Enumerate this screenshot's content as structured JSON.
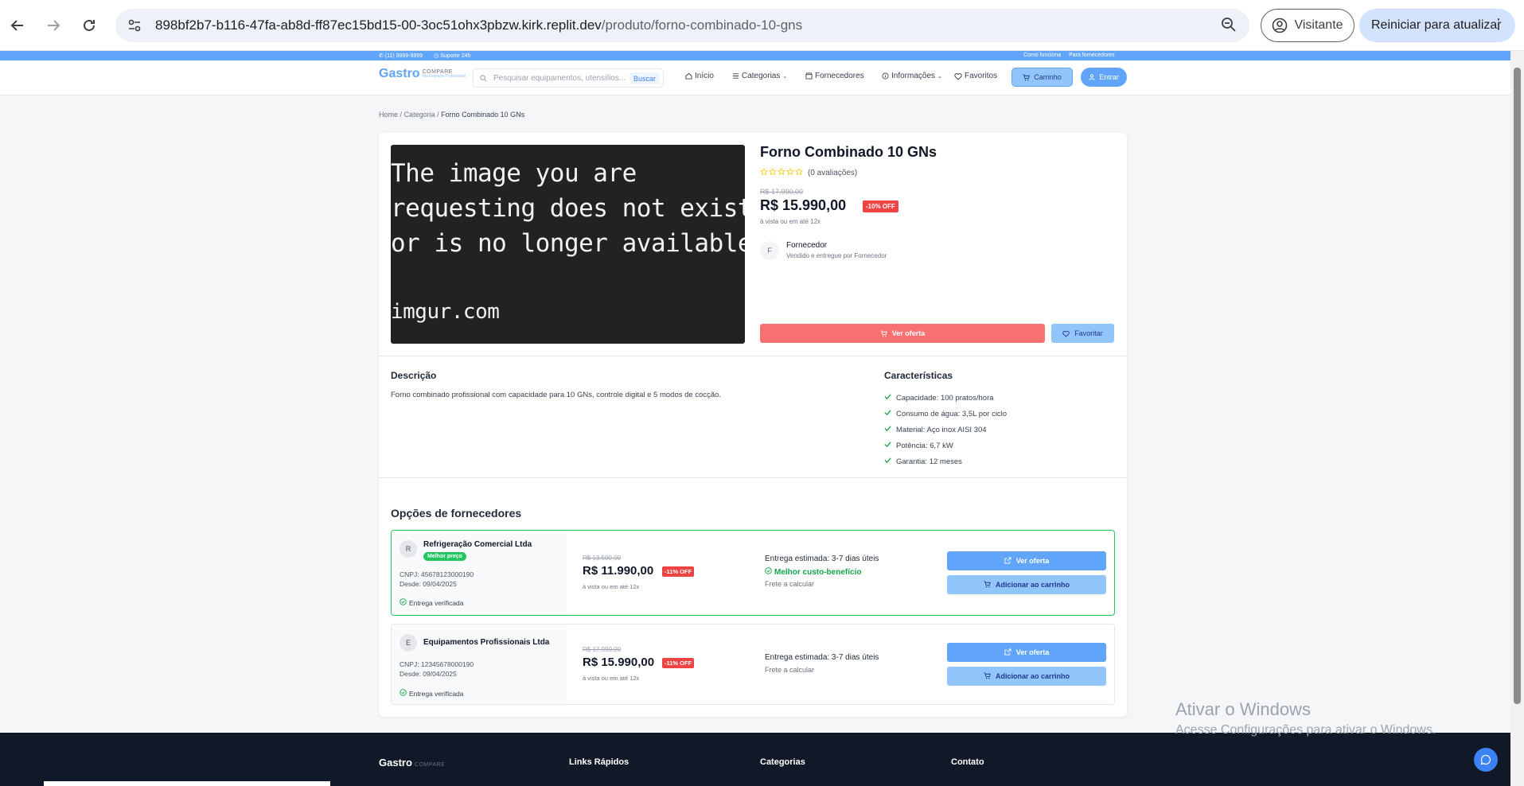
{
  "browser": {
    "url_host": "898bf2b7-b116-47fa-ab8d-ff87ec15bd15-00-3oc51ohx3pbzw.kirk.replit.dev",
    "url_path": "/produto/forno-combinado-10-gns",
    "profile_label": "Visitante",
    "update_label": "Reiniciar para atualizar"
  },
  "topbar": {
    "phone": "(11) 9999-9999",
    "support": "Suporte 24h",
    "how_it_works": "Como funciona",
    "for_suppliers": "Para fornecedores"
  },
  "header": {
    "logo_main": "Gastro",
    "logo_sub": "COMPARE",
    "logo_tag": "Marketplace Profissional",
    "search_placeholder": "Pesquisar equipamentos, utensílios...",
    "search_button": "Buscar",
    "nav": {
      "home": "Início",
      "categories": "Categorias",
      "suppliers": "Fornecedores",
      "info": "Informações",
      "favorites": "Favoritos",
      "cart": "Carrinho",
      "login": "Entrar"
    }
  },
  "breadcrumb": {
    "home": "Home",
    "category": "Categoria",
    "current": "Forno Combinado 10 GNs",
    "sep": "/"
  },
  "product": {
    "image_text": [
      "The image you are",
      "requesting does not exist",
      "or is no longer available.",
      "imgur.com"
    ],
    "title": "Forno Combinado 10 GNs",
    "rating_count": "(0 avaliações)",
    "rating": 0,
    "old_price": "R$ 17.990,00",
    "price": "R$ 15.990,00",
    "discount": "-10% OFF",
    "installments": "à vista ou em até 12x",
    "supplier_initial": "F",
    "supplier_name": "Fornecedor",
    "supplier_sub": "Vendido e entregue por Fornecedor",
    "offer_button": "Ver oferta",
    "favorite_button": "Favoritar"
  },
  "description": {
    "title": "Descrição",
    "text": "Forno combinado profissional com capacidade para 10 GNs, controle digital e 5 modos de cocção."
  },
  "features": {
    "title": "Características",
    "items": [
      "Capacidade: 100 pratos/hora",
      "Consumo de água: 3,5L por ciclo",
      "Material: Aço inox AISI 304",
      "Potência: 6,7 kW",
      "Garantia: 12 meses"
    ]
  },
  "options": {
    "title": "Opções de fornecedores",
    "items": [
      {
        "initial": "R",
        "name": "Refrigeração Comercial Ltda",
        "badge": "Melhor preço",
        "cnpj": "CNPJ: 45678123000190",
        "since": "Desde: 09/04/2025",
        "verified": "Entrega verificada",
        "old_price": "R$ 13.500,00",
        "price": "R$ 11.990,00",
        "discount": "-11% OFF",
        "installments": "à vista ou em até 12x",
        "delivery": "Entrega estimada: 3-7 dias úteis",
        "highlight": "Melhor custo-benefício",
        "shipping": "Frete a calcular",
        "offer_button": "Ver oferta",
        "cart_button": "Adicionar ao carrinho"
      },
      {
        "initial": "E",
        "name": "Equipamentos Profissionais Ltda",
        "cnpj": "CNPJ: 12345678000190",
        "since": "Desde: 09/04/2025",
        "verified": "Entrega verificada",
        "old_price": "R$ 17.990,00",
        "price": "R$ 15.990,00",
        "discount": "-11% OFF",
        "installments": "à vista ou em até 12x",
        "delivery": "Entrega estimada: 3-7 dias úteis",
        "shipping": "Frete a calcular",
        "offer_button": "Ver oferta",
        "cart_button": "Adicionar ao carrinho"
      }
    ]
  },
  "footer": {
    "logo_main": "Gastro",
    "logo_sub": "COMPARE",
    "quick_links": "Links Rápidos",
    "categories": "Categorias",
    "contact": "Contato"
  },
  "windows": {
    "line1": "Ativar o Windows",
    "line2": "Acesse Configurações para ativar o Windows."
  },
  "colors": {
    "accent": "#60a5fa",
    "danger": "#ef4444",
    "success": "#22c55e",
    "footer": "#111827"
  }
}
